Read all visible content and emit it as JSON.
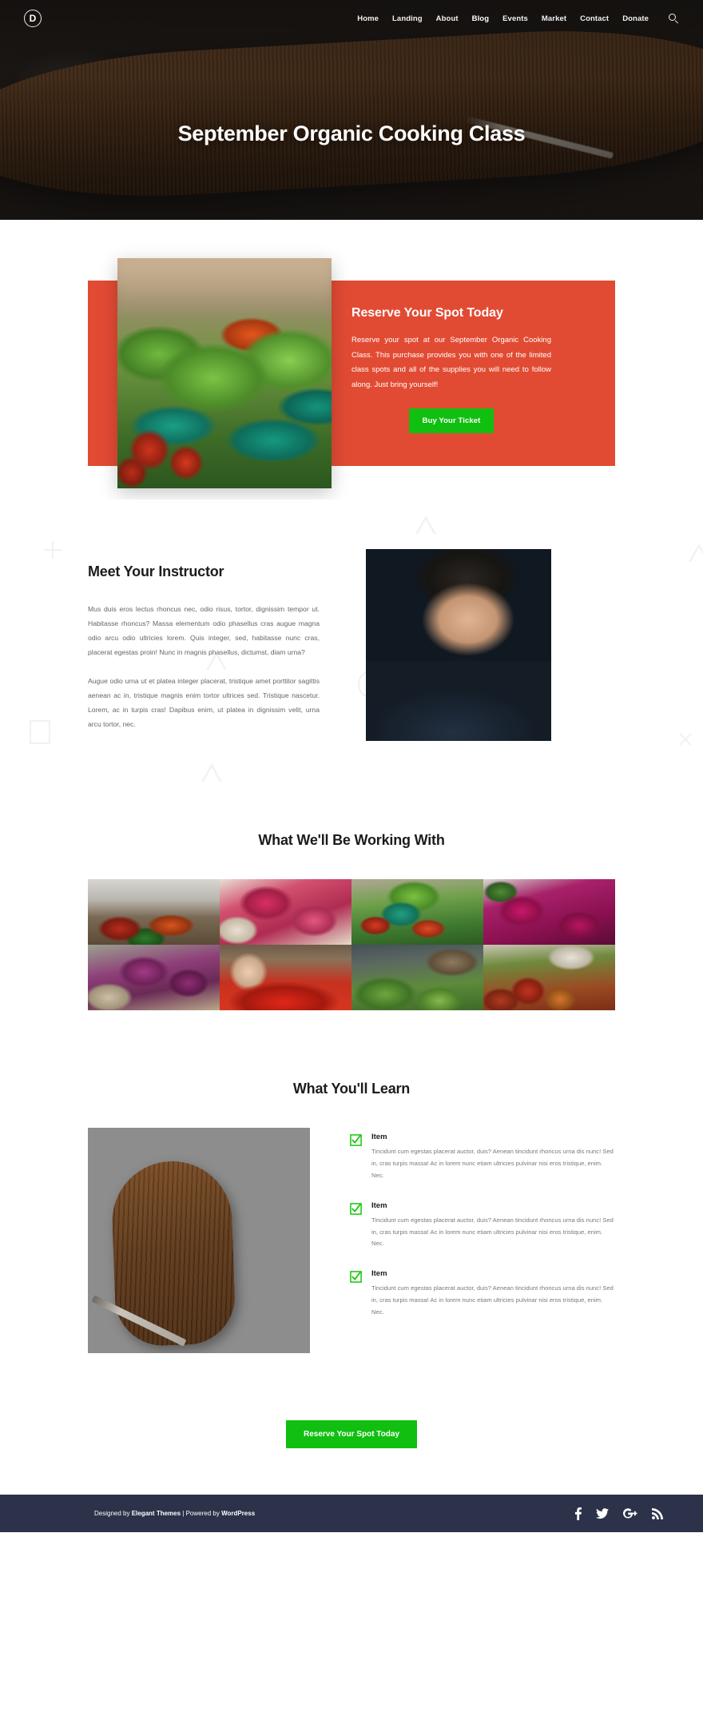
{
  "header": {
    "logo_letter": "D",
    "nav": [
      {
        "label": "Home",
        "active": false
      },
      {
        "label": "Landing",
        "active": false
      },
      {
        "label": "About",
        "active": false
      },
      {
        "label": "Blog",
        "active": true
      },
      {
        "label": "Events",
        "active": false
      },
      {
        "label": "Market",
        "active": false
      },
      {
        "label": "Contact",
        "active": false
      },
      {
        "label": "Donate",
        "active": false
      }
    ],
    "search_label": "Search"
  },
  "hero": {
    "title": "September Organic Cooking Class"
  },
  "cta": {
    "heading": "Reserve Your Spot Today",
    "body": "Reserve your spot at our September Organic Cooking Class. This purchase provides you with one of the limited class spots and all of the supplies you will need to follow along. Just bring yourself!",
    "button_label": "Buy Your Ticket",
    "panel_color": "#e24b33",
    "button_color": "#10bf10"
  },
  "instructor": {
    "heading": "Meet Your Instructor",
    "paragraphs": [
      "Mus duis eros lectus rhoncus nec, odio risus, tortor, dignissim tempor ut. Habitasse rhoncus? Massa elementum odio phasellus cras augue magna odio arcu odio ultricies lorem. Quis integer, sed, habitasse nunc cras, placerat egestas proin! Nunc in magnis phasellus, dictumst, diam urna?",
      "Augue odio urna ut et platea integer placerat, tristique amet porttitor sagittis aenean ac in, tristique magnis enim tortor ultrices sed. Tristique nascetur. Lorem, ac in turpis cras! Dapibus enim, ut platea in dignissim velit, urna arcu tortor, nec."
    ]
  },
  "gallery": {
    "heading": "What We'll Be Working With",
    "items": [
      {
        "caption": "market-produce-crates"
      },
      {
        "caption": "radishes-closeup"
      },
      {
        "caption": "market-stall-baskets"
      },
      {
        "caption": "red-radish-bunch"
      },
      {
        "caption": "purple-radish-bundles"
      },
      {
        "caption": "hand-picking-tomatoes"
      },
      {
        "caption": "leafy-greens-stand"
      },
      {
        "caption": "mixed-root-vegetables"
      }
    ]
  },
  "learn": {
    "heading": "What You'll Learn",
    "photo_caption": "cutting-board-ingredients",
    "items": [
      {
        "title": "Item",
        "body": "Tincidunt cum egestas placerat auctor, duis? Aenean tincidunt rhoncus urna dis nunc! Sed in, cras turpis massa! Ac in lorem nunc etiam ultricies pulvinar nisi eros tristique, enim. Nec."
      },
      {
        "title": "Item",
        "body": "Tincidunt cum egestas placerat auctor, duis? Aenean tincidunt rhoncus urna dis nunc! Sed in, cras turpis massa! Ac in lorem nunc etiam ultricies pulvinar nisi eros tristique, enim. Nec."
      },
      {
        "title": "Item",
        "body": "Tincidunt cum egestas placerat auctor, duis? Aenean tincidunt rhoncus urna dis nunc! Sed in, cras turpis massa! Ac in lorem nunc etiam ultricies pulvinar nisi eros tristique, enim. Nec."
      }
    ],
    "check_color": "#16c60c"
  },
  "final_cta": {
    "button_label": "Reserve Your Spot Today"
  },
  "footer": {
    "credit_prefix": "Designed by ",
    "credit_brand": "Elegant Themes",
    "credit_middle": " | Powered by ",
    "credit_platform": "WordPress",
    "background": "#2b3249",
    "social": [
      {
        "name": "facebook",
        "glyph": "f"
      },
      {
        "name": "twitter",
        "glyph": "🐦"
      },
      {
        "name": "google-plus",
        "glyph": "G+"
      },
      {
        "name": "rss",
        "glyph": "◔"
      }
    ]
  }
}
